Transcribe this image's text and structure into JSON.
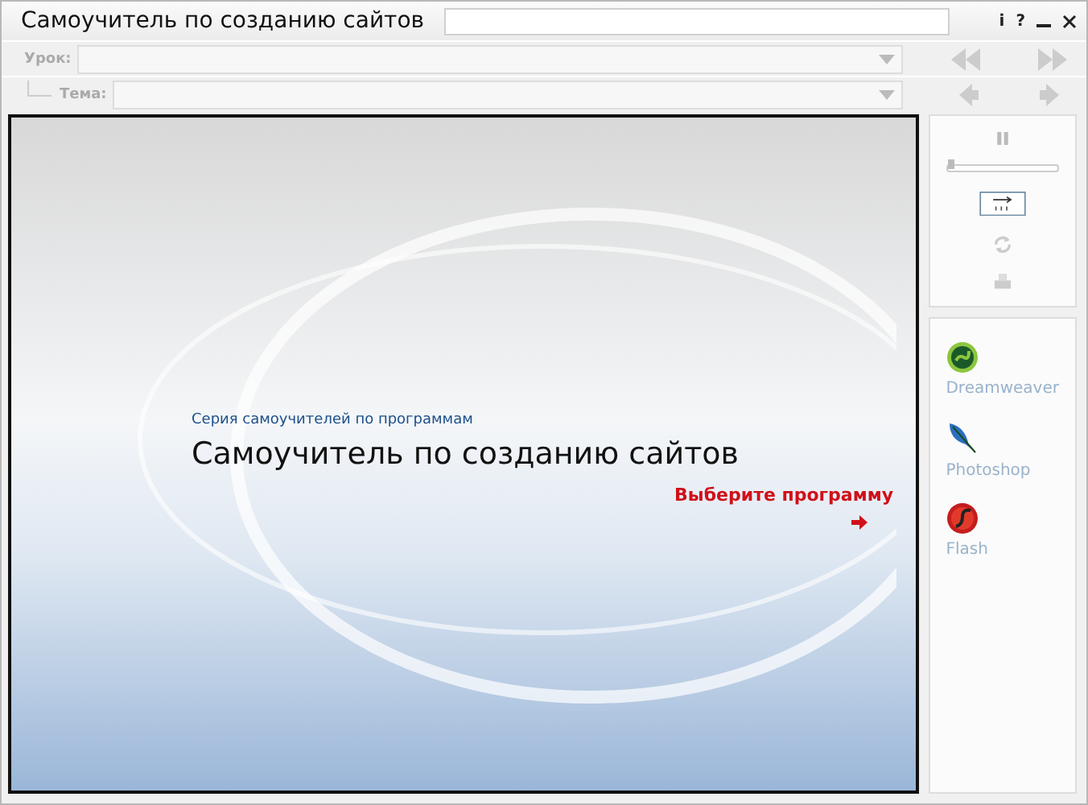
{
  "window": {
    "title": "Самоучитель по созданию сайтов",
    "buttons": [
      "i",
      "?"
    ]
  },
  "selectors": [
    {
      "label": "Урок:",
      "disabled": true,
      "indented": false
    },
    {
      "label": "Тема:",
      "disabled": true,
      "indented": true
    }
  ],
  "slide": {
    "series": "Серия самоучителей по программам",
    "heading": "Самоучитель по созданию сайтов",
    "call_to_action": "Выберите программу"
  },
  "player": {
    "paused": false,
    "level": 0.0
  },
  "programs": [
    {
      "name": "Dreamweaver",
      "kind": "dreamweaver"
    },
    {
      "name": "Photoshop",
      "kind": "photoshop"
    },
    {
      "name": "Flash",
      "kind": "flash"
    }
  ]
}
